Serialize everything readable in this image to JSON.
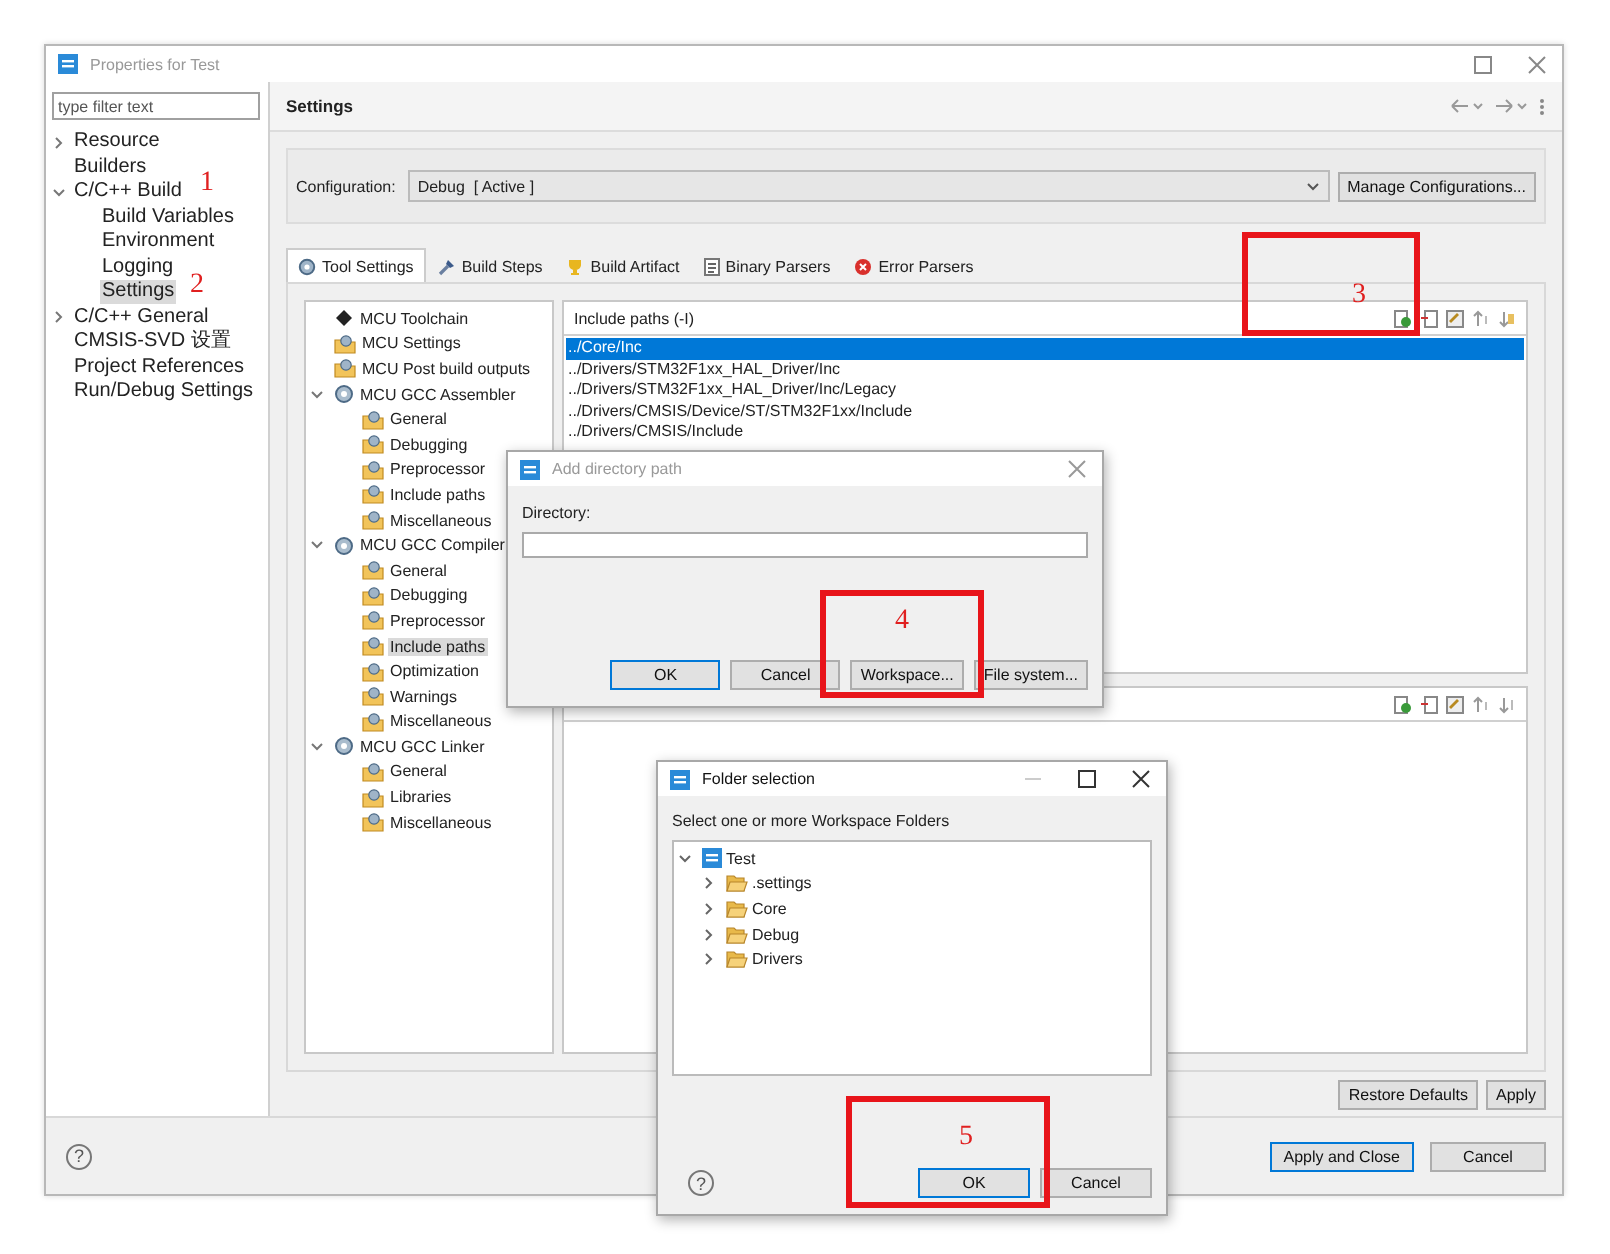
{
  "window": {
    "title": "Properties for Test",
    "active": false
  },
  "filter": {
    "placeholder": "type filter text"
  },
  "nav": [
    {
      "label": "Resource",
      "expanded": false,
      "selected": false
    },
    {
      "label": "Builders",
      "selected": false
    },
    {
      "label": "C/C++ Build",
      "expanded": true,
      "selected": false,
      "children": [
        {
          "label": "Build Variables",
          "selected": false
        },
        {
          "label": "Environment",
          "selected": false
        },
        {
          "label": "Logging",
          "selected": false
        },
        {
          "label": "Settings",
          "selected": true
        }
      ]
    },
    {
      "label": "C/C++ General",
      "expanded": false,
      "selected": false
    },
    {
      "label": "CMSIS-SVD 设置",
      "selected": false
    },
    {
      "label": "Project References",
      "selected": false
    },
    {
      "label": "Run/Debug Settings",
      "selected": false
    }
  ],
  "page_title": "Settings",
  "configuration": {
    "label": "Configuration:",
    "value": "Debug  [ Active ]",
    "button": "Manage Configurations..."
  },
  "tabs": [
    {
      "label": "Tool Settings",
      "kind": "gear",
      "selected": true
    },
    {
      "label": "Build Steps",
      "kind": "brush",
      "selected": false
    },
    {
      "label": "Build Artifact",
      "kind": "trophy",
      "selected": false
    },
    {
      "label": "Binary Parsers",
      "kind": "document",
      "selected": false
    },
    {
      "label": "Error Parsers",
      "kind": "error",
      "selected": false
    }
  ],
  "tool_tree": [
    {
      "label": "MCU Toolchain",
      "kind": "chip",
      "selected": false
    },
    {
      "label": "MCU Settings",
      "kind": "option",
      "selected": false
    },
    {
      "label": "MCU Post build outputs",
      "kind": "option",
      "selected": false
    },
    {
      "label": "MCU GCC Assembler",
      "kind": "tool",
      "expanded": true,
      "selected": false,
      "children": [
        {
          "label": "General",
          "kind": "option",
          "selected": false
        },
        {
          "label": "Debugging",
          "kind": "option",
          "selected": false
        },
        {
          "label": "Preprocessor",
          "kind": "option",
          "selected": false
        },
        {
          "label": "Include paths",
          "kind": "option",
          "selected": false
        },
        {
          "label": "Miscellaneous",
          "kind": "option",
          "selected": false
        }
      ]
    },
    {
      "label": "MCU GCC Compiler",
      "kind": "tool",
      "expanded": true,
      "selected": false,
      "children": [
        {
          "label": "General",
          "kind": "option",
          "selected": false
        },
        {
          "label": "Debugging",
          "kind": "option",
          "selected": false
        },
        {
          "label": "Preprocessor",
          "kind": "option",
          "selected": false
        },
        {
          "label": "Include paths",
          "kind": "option",
          "selected": true
        },
        {
          "label": "Optimization",
          "kind": "option",
          "selected": false
        },
        {
          "label": "Warnings",
          "kind": "option",
          "selected": false
        },
        {
          "label": "Miscellaneous",
          "kind": "option",
          "selected": false
        }
      ]
    },
    {
      "label": "MCU GCC Linker",
      "kind": "tool",
      "expanded": true,
      "selected": false,
      "children": [
        {
          "label": "General",
          "kind": "option",
          "selected": false
        },
        {
          "label": "Libraries",
          "kind": "option",
          "selected": false
        },
        {
          "label": "Miscellaneous",
          "kind": "option",
          "selected": false
        }
      ]
    }
  ],
  "include_paths": {
    "title": "Include paths (-I)",
    "items": [
      {
        "path": "../Core/Inc",
        "selected": true
      },
      {
        "path": "../Drivers/STM32F1xx_HAL_Driver/Inc",
        "selected": false
      },
      {
        "path": "../Drivers/STM32F1xx_HAL_Driver/Inc/Legacy",
        "selected": false
      },
      {
        "path": "../Drivers/CMSIS/Device/ST/STM32F1xx/Include",
        "selected": false
      },
      {
        "path": "../Drivers/CMSIS/Include",
        "selected": false
      }
    ]
  },
  "page_buttons": [
    {
      "label": "Restore Defaults",
      "default": false
    },
    {
      "label": "Apply",
      "default": false
    }
  ],
  "footer": {
    "help": "?",
    "buttons": [
      {
        "label": "Apply and Close",
        "default": true
      },
      {
        "label": "Cancel",
        "default": false
      }
    ]
  },
  "add_dialog": {
    "title": "Add directory path",
    "active": false,
    "label": "Directory:",
    "buttons": [
      {
        "label": "OK",
        "default": true
      },
      {
        "label": "Cancel",
        "default": false
      },
      {
        "label": "Workspace...",
        "default": false
      },
      {
        "label": "File system...",
        "default": false
      }
    ]
  },
  "folder_dialog": {
    "title": "Folder selection",
    "active": true,
    "prompt": "Select one or more Workspace Folders",
    "tree": [
      {
        "label": "Test",
        "kind": "project",
        "expanded": true,
        "children": [
          {
            "label": ".settings",
            "kind": "folder",
            "expanded": false
          },
          {
            "label": "Core",
            "kind": "folder",
            "expanded": false
          },
          {
            "label": "Debug",
            "kind": "folder",
            "expanded": false
          },
          {
            "label": "Drivers",
            "kind": "folder",
            "expanded": false
          }
        ]
      }
    ],
    "help": "?",
    "buttons": [
      {
        "label": "OK",
        "default": true
      },
      {
        "label": "Cancel",
        "default": false
      }
    ]
  },
  "annotations": [
    {
      "kind": "number",
      "number": "1"
    },
    {
      "kind": "number",
      "number": "2"
    },
    {
      "kind": "box",
      "number": "3"
    },
    {
      "kind": "box",
      "number": "4"
    },
    {
      "kind": "box",
      "number": "5"
    }
  ]
}
